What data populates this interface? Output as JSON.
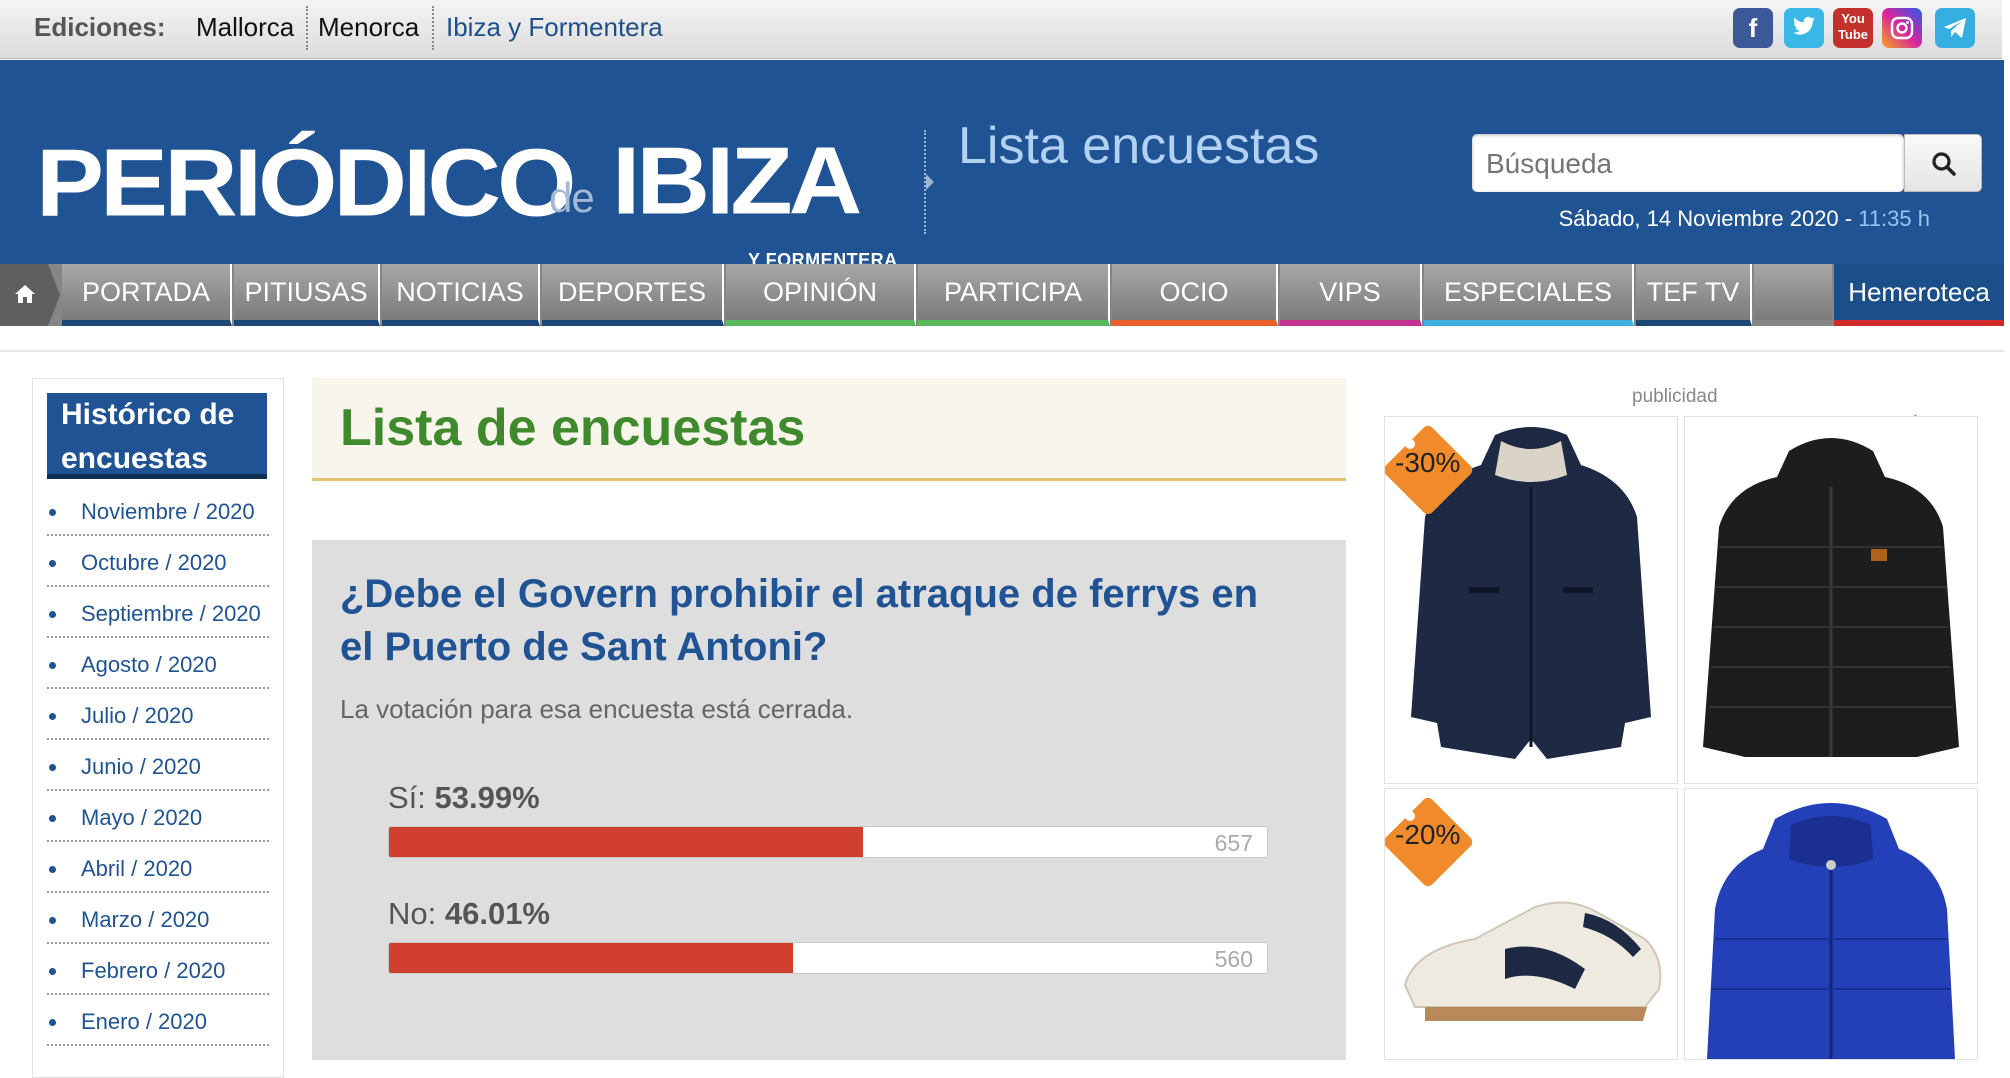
{
  "editions": {
    "label": "Ediciones:",
    "items": [
      "Mallorca",
      "Menorca",
      "Ibiza y Formentera"
    ]
  },
  "social": {
    "facebook": "facebook-icon",
    "twitter": "twitter-icon",
    "youtube_label": "You Tube",
    "instagram": "instagram-icon",
    "telegram": "telegram-icon"
  },
  "header": {
    "logo_main": "PERIÓDICO",
    "logo_de": "de",
    "logo_ibiza": "IBIZA",
    "logo_sub": "Y FORMENTERA",
    "section_title": "Lista encuestas",
    "search_placeholder": "Búsqueda",
    "date": "Sábado, 14 Noviembre 2020 - ",
    "time": "11:35 h"
  },
  "nav": {
    "items": [
      {
        "label": "PORTADA",
        "color": "#1c4878"
      },
      {
        "label": "PITIUSAS",
        "color": "#1c4878"
      },
      {
        "label": "NOTICIAS",
        "color": "#1c4878"
      },
      {
        "label": "DEPORTES",
        "color": "#1c4878"
      },
      {
        "label": "OPINIÓN",
        "color": "#5cb85c"
      },
      {
        "label": "PARTICIPA",
        "color": "#5cb85c"
      },
      {
        "label": "OCIO",
        "color": "#e8602c"
      },
      {
        "label": "VIPS",
        "color": "#c2338f"
      },
      {
        "label": "ESPECIALES",
        "color": "#3fb0e0"
      },
      {
        "label": "TEF TV",
        "color": "#1c4878"
      }
    ],
    "hemeroteca": "Hemeroteca"
  },
  "sidebar": {
    "title_line1": "Histórico de",
    "title_line2": "encuestas",
    "months": [
      "Noviembre / 2020",
      "Octubre / 2020",
      "Septiembre / 2020",
      "Agosto / 2020",
      "Julio / 2020",
      "Junio / 2020",
      "Mayo / 2020",
      "Abril / 2020",
      "Marzo / 2020",
      "Febrero / 2020",
      "Enero / 2020"
    ]
  },
  "main": {
    "title": "Lista de encuestas",
    "poll": {
      "question": "¿Debe el Govern prohibir el atraque de ferrys en el Puerto de Sant Antoni?",
      "status": "La votación para esa encuesta está cerrada.",
      "options": [
        {
          "label": "Sí: ",
          "percent": "53.99%",
          "fraction": 0.5399,
          "votes": "657"
        },
        {
          "label": "No: ",
          "percent": "46.01%",
          "fraction": 0.4601,
          "votes": "560"
        }
      ]
    }
  },
  "ad": {
    "label": "publicidad",
    "discounts": [
      "-30%",
      "-20%"
    ],
    "colors": {
      "tag": "#f08a2a",
      "navy_jacket": "#1e2a44",
      "black_jacket": "#1d1d1d",
      "blue_jacket": "#2440b8"
    }
  }
}
